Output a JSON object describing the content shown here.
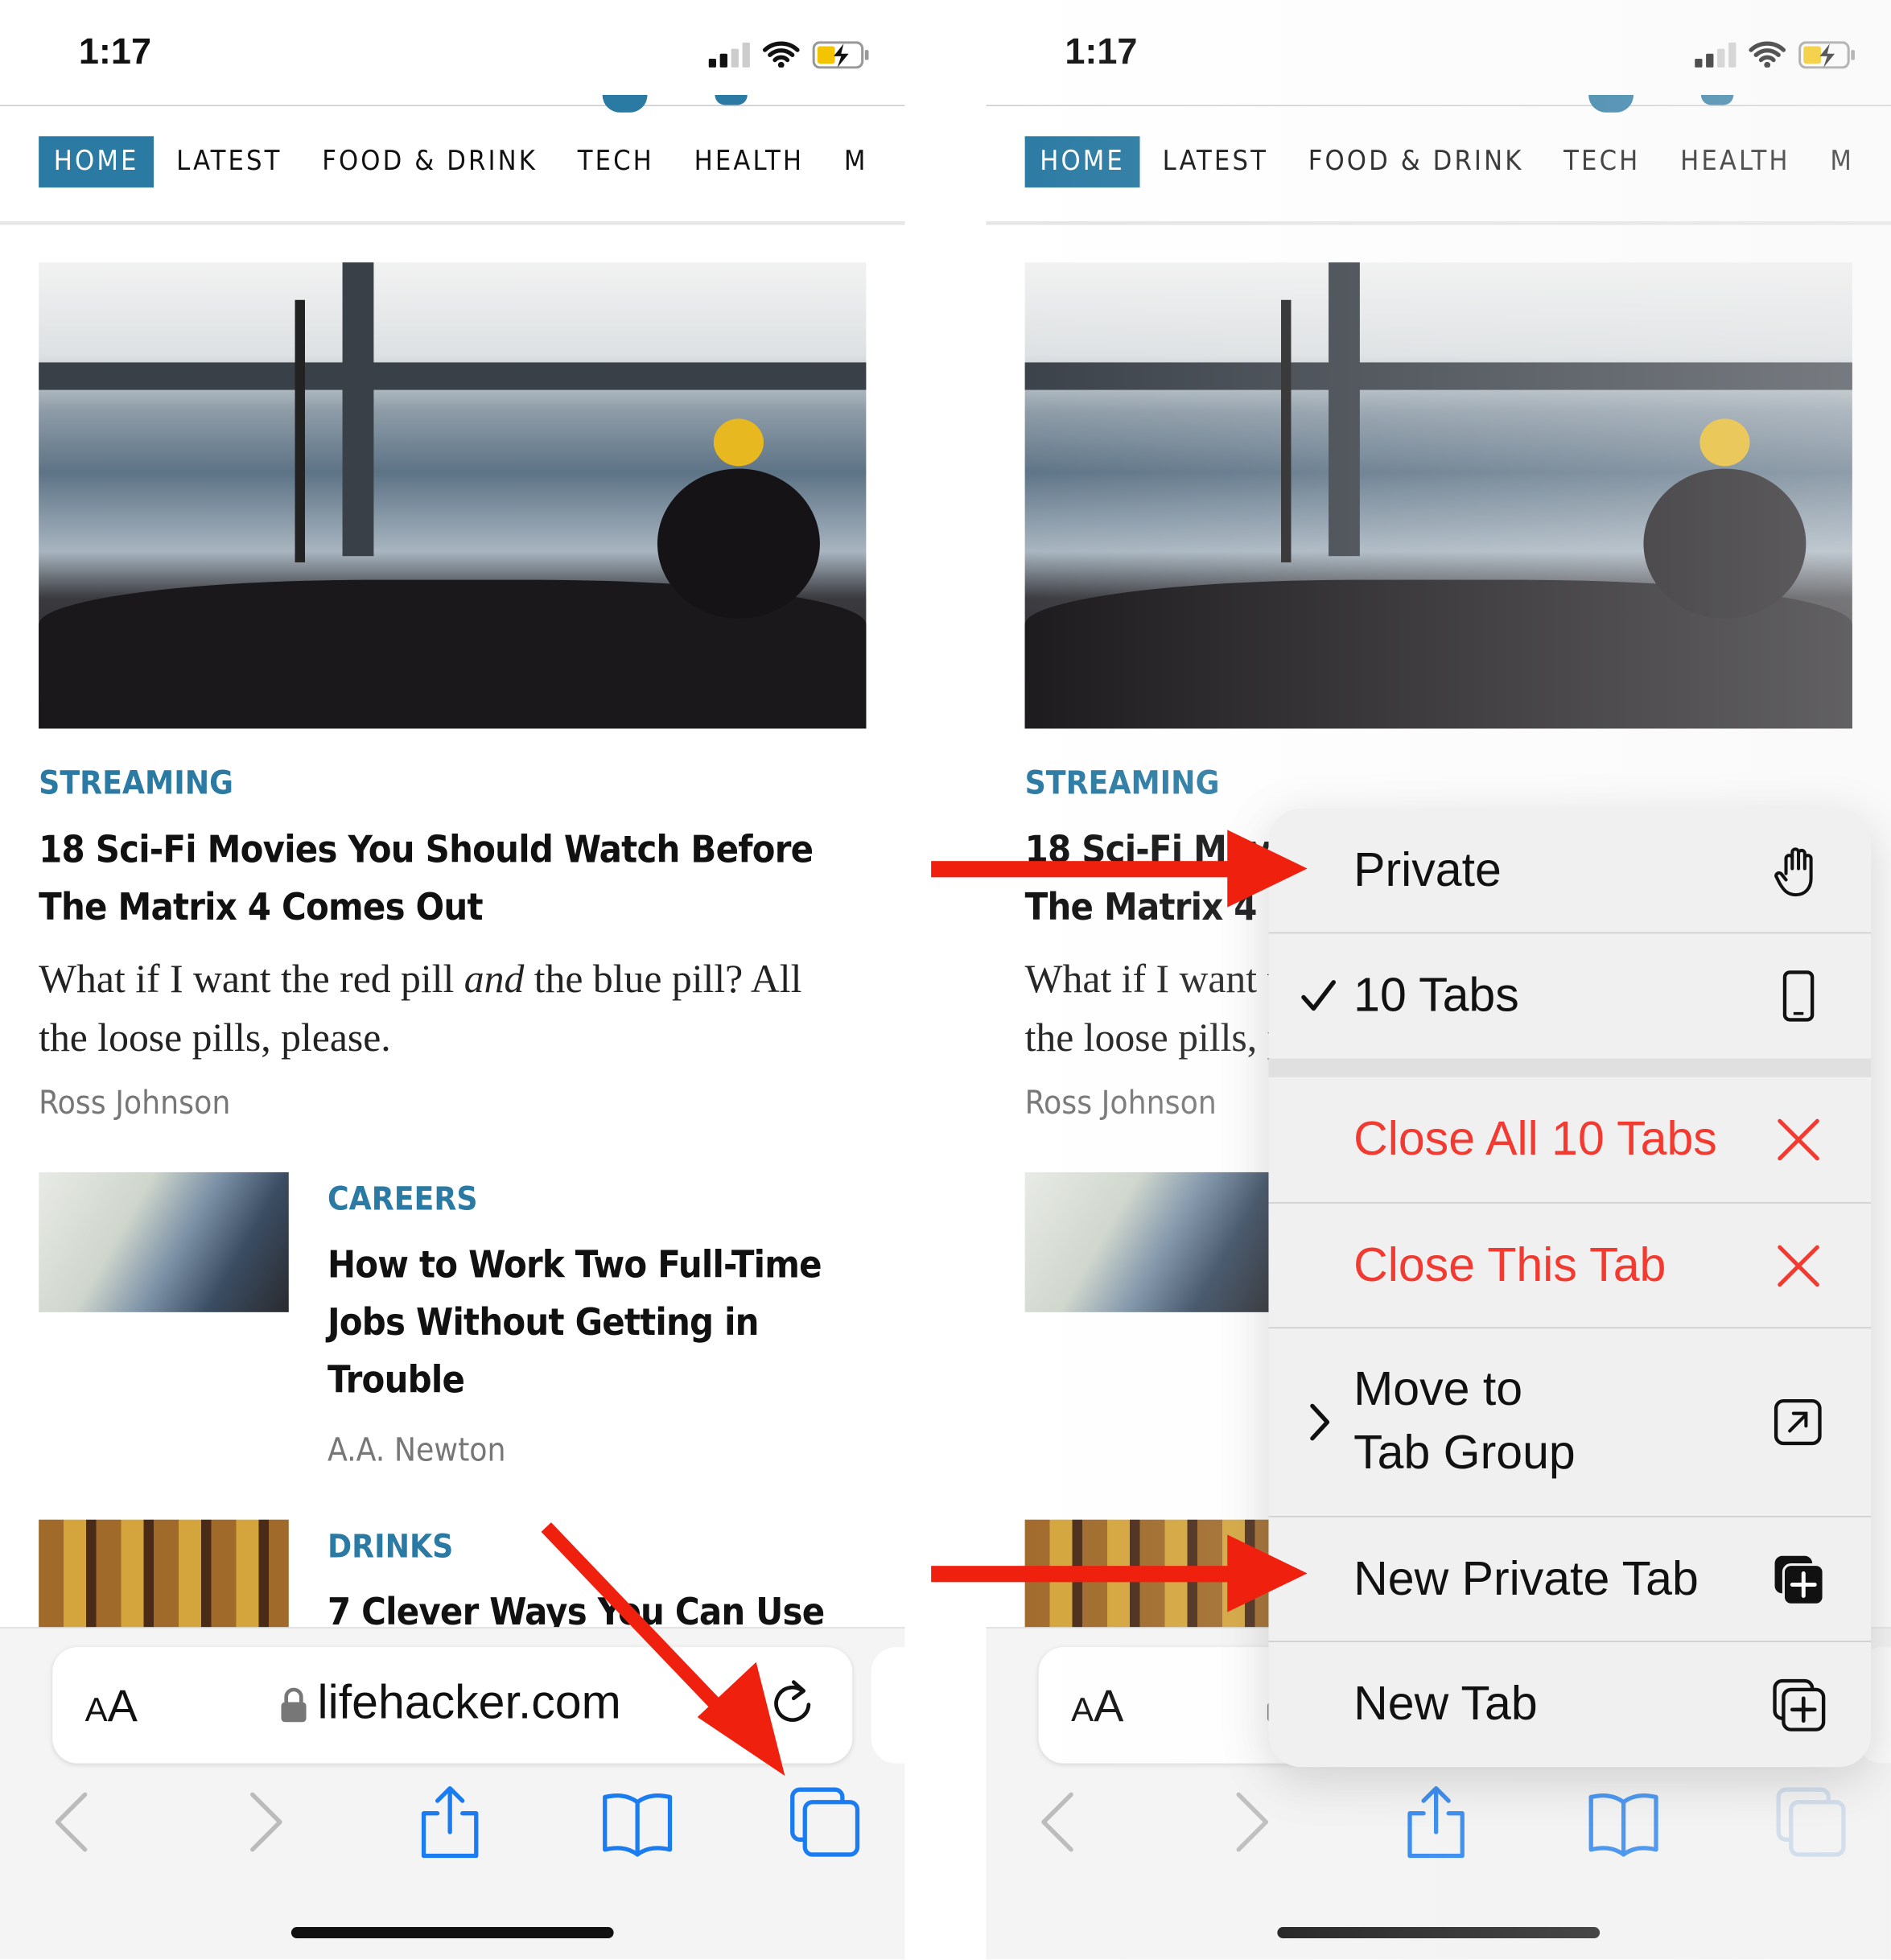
{
  "status": {
    "time": "1:17"
  },
  "nav": {
    "items": [
      "HOME",
      "LATEST",
      "FOOD & DRINK",
      "TECH",
      "HEALTH",
      "M"
    ]
  },
  "articles": [
    {
      "category": "STREAMING",
      "title_line1": "18 Sci-Fi Movies You Should Watch Before",
      "title_line2": "The Matrix 4 Comes Out",
      "desc_a": "What if I want the red pill ",
      "desc_em": "and",
      "desc_b": " the blue pill? All",
      "desc_line2": "the loose pills, please.",
      "author": "Ross Johnson"
    },
    {
      "category": "CAREERS",
      "title_line1": "How to Work Two Full-Time",
      "title_line2": "Jobs Without Getting in",
      "title_line3": "Trouble",
      "author": "A.A. Newton"
    },
    {
      "category": "DRINKS",
      "title_line1": "7 Clever Ways You Can Use"
    }
  ],
  "browser": {
    "aa_small": "A",
    "aa_large": "A",
    "url": "lifehacker.com"
  },
  "menu": {
    "items": [
      {
        "label": "Private",
        "icon": "hand-icon"
      },
      {
        "label": "10 Tabs",
        "icon": "phone-icon",
        "checked": true
      },
      {
        "label": "Close All 10 Tabs",
        "icon": "close-icon",
        "destructive": true
      },
      {
        "label": "Close This Tab",
        "icon": "close-icon",
        "destructive": true
      },
      {
        "label_line1": "Move to",
        "label_line2": "Tab Group",
        "icon": "move-to-icon",
        "submenu": true
      },
      {
        "label": "New Private Tab",
        "icon": "new-private-tab-icon"
      },
      {
        "label": "New Tab",
        "icon": "new-tab-icon"
      }
    ]
  },
  "colors": {
    "accent": "#2a7aa3",
    "destructive": "#f23a30",
    "annotation_arrow": "#f0200f",
    "ios_blue": "#1a7cf0"
  }
}
